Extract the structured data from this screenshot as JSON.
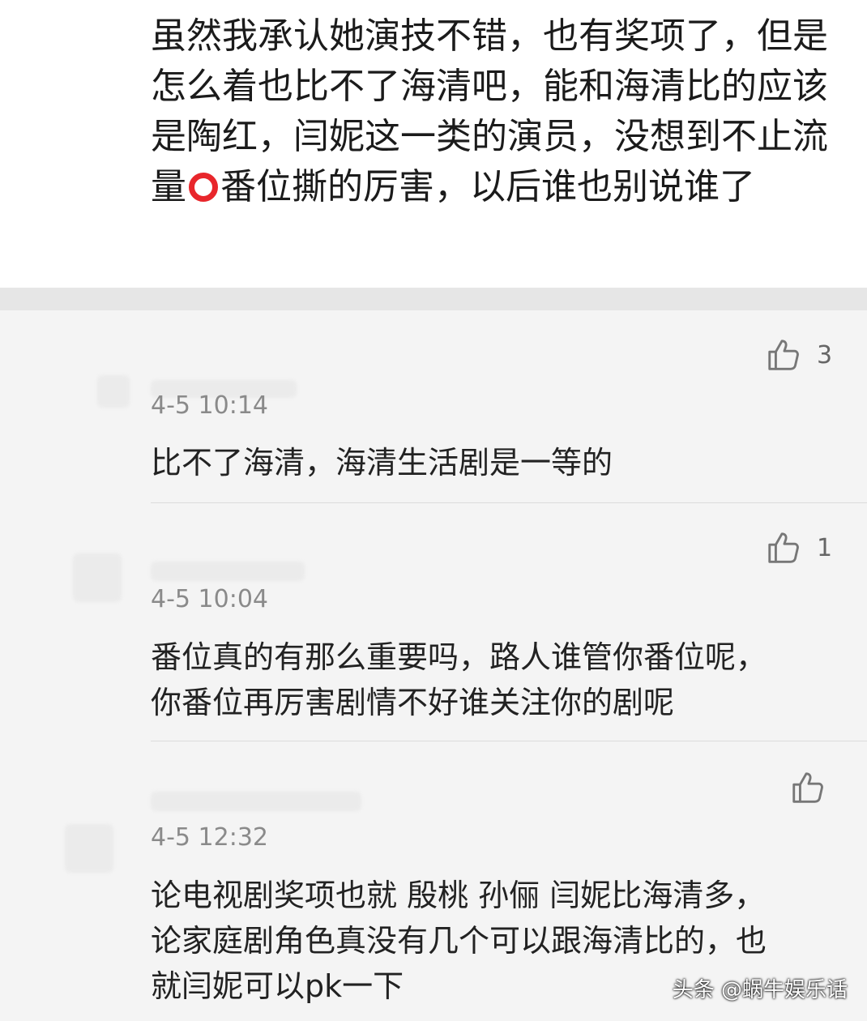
{
  "post": {
    "text_before_icon": "虽然我承认她演技不错，也有奖项了，但是怎么着也比不了海清吧，能和海清比的应该是陶红，闫妮这一类的演员，没想到不止流量",
    "inline_icon": "red-circle-icon",
    "text_after_icon": "番位撕的厉害，以后谁也别说谁了"
  },
  "comments": [
    {
      "likes": "3",
      "time": "4-5 10:14",
      "text": "比不了海清，海清生活剧是一等的"
    },
    {
      "likes": "1",
      "time": "4-5 10:04",
      "text": "番位真的有那么重要吗，路人谁管你番位呢，\n你番位再厉害剧情不好谁关注你的剧呢"
    },
    {
      "likes": "",
      "time": "4-5 12:32",
      "text": "论电视剧奖项也就 殷桃 孙俪 闫妮比海清多，\n论家庭剧角色真没有几个可以跟海清比的，也\n就闫妮可以pk一下"
    }
  ],
  "icons": {
    "like": "thumbs-up-icon"
  },
  "colors": {
    "ring": "#e8262b",
    "background": "#f4f4f4",
    "card": "#ffffff"
  },
  "watermark": "头条 @蜗牛娱乐话"
}
